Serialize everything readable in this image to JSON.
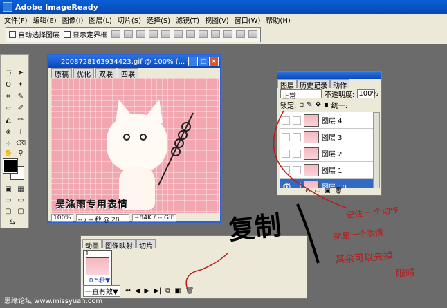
{
  "app": {
    "title": "Adobe ImageReady"
  },
  "menu": [
    "文件(F)",
    "编辑(E)",
    "图像(I)",
    "图层(L)",
    "切片(S)",
    "选择(S)",
    "滤镜(T)",
    "视图(V)",
    "窗口(W)",
    "帮助(H)"
  ],
  "options": {
    "auto_select": "自动选择图层",
    "show_bounds": "显示定界框"
  },
  "image_window": {
    "title": "2008728163934423.gif @ 100% (...",
    "tabs": [
      "原稿",
      "优化",
      "双联",
      "四联"
    ],
    "caption": "吴涤雨专用表情",
    "zoom": "100%",
    "time": "-- / -- 秒 @ 28....",
    "size": "~84K / -- GIF"
  },
  "layers": {
    "tabs": [
      "图层",
      "历史记录",
      "动作"
    ],
    "blend_mode": "正常",
    "opacity_label": "不透明度:",
    "opacity_value": "100%",
    "lock_label": "锁定:",
    "unify_label": "统一:",
    "items": [
      {
        "name": "图层 4",
        "active": false
      },
      {
        "name": "图层 3",
        "active": false
      },
      {
        "name": "图层 2",
        "active": false
      },
      {
        "name": "图层 1",
        "active": false
      },
      {
        "name": "图层 10",
        "active": true
      }
    ]
  },
  "animation": {
    "tabs": [
      "动画",
      "图像映射",
      "切片"
    ],
    "frame_number": "1",
    "frame_delay": "0.5秒▼",
    "loop": "一直有效▼"
  },
  "annotations": {
    "big_word": "复制",
    "note1": "记住 一个动作",
    "note2": "就是一个表情",
    "note3": "其余可以先掉",
    "note4": "眼睛"
  },
  "watermark": "思缘论坛 www.missyuan.com"
}
